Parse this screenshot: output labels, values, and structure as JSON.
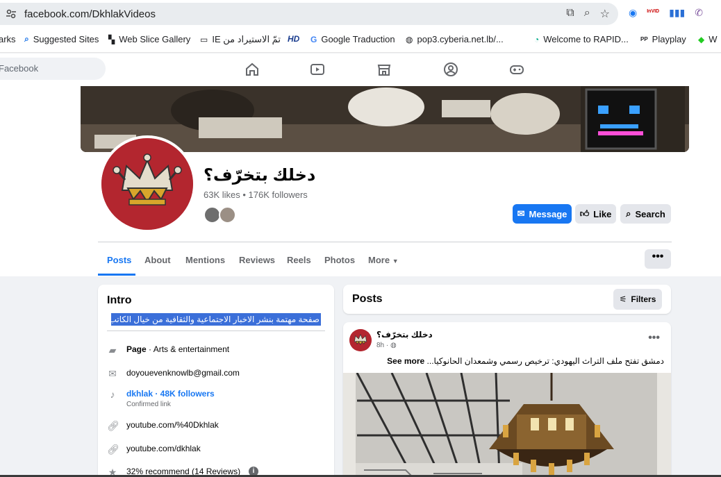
{
  "browser": {
    "url": "facebook.com/DkhlakVideos",
    "ext_hd": "HD",
    "ext_invid": "InVID",
    "bookmarks": [
      {
        "label": "arks",
        "icon": ""
      },
      {
        "label": "Suggested Sites",
        "icon": "search-icon"
      },
      {
        "label": "Web Slice Gallery",
        "icon": "slice-icon"
      },
      {
        "label": "تمّ الاستيراد من IE",
        "icon": "folder-icon"
      },
      {
        "label": "HD",
        "icon": "hd-icon"
      },
      {
        "label": "Google Traduction",
        "icon": "translate-icon"
      },
      {
        "label": "pop3.cyberia.net.lb/...",
        "icon": "globe-icon"
      },
      {
        "label": "Welcome to RAPID...",
        "icon": "rapid-icon"
      },
      {
        "label": "Playplay",
        "icon": "playplay-icon"
      },
      {
        "label": "W",
        "icon": "w-icon"
      }
    ]
  },
  "fb": {
    "search_placeholder": "Facebook",
    "nav": [
      "home-icon",
      "video-icon",
      "marketplace-icon",
      "groups-icon",
      "gaming-icon"
    ]
  },
  "page": {
    "name": "دخلك بتخرّف؟",
    "stats": "63K likes • 176K followers",
    "buttons": {
      "message": "Message",
      "like": "Like",
      "search": "Search"
    },
    "tabs": [
      "Posts",
      "About",
      "Mentions",
      "Reviews",
      "Reels",
      "Photos",
      "More"
    ],
    "more_dots": "•••"
  },
  "intro": {
    "title": "Intro",
    "bio": "صفحة مهتمة بنشر الاخبار الاجتماعية والثقافية من خيال الكاتب.",
    "category_label": "Page",
    "category_value": " · Arts & entertainment",
    "email": "doyouevenknowlb@gmail.com",
    "tiktok": "dkhlak · 48K followers",
    "tiktok_sub": "Confirmed link",
    "yt1": "youtube.com/%40Dkhlak",
    "yt2": "youtube.com/dkhlak",
    "recommend": "32% recommend (14 Reviews)"
  },
  "posts": {
    "title": "Posts",
    "filters": "Filters",
    "post": {
      "author": "دخلك بتخرّف؟",
      "time": "8h ·",
      "text": "دمشق تفتح ملف التراث اليهودي: ترخيص رسمي وشمعدان الحانوكيا...",
      "see_more": "See more",
      "dots": "•••"
    }
  },
  "colors": {
    "accent": "#1877f2",
    "avatar_bg": "#b3262f",
    "highlight": "#3b6fd9"
  }
}
